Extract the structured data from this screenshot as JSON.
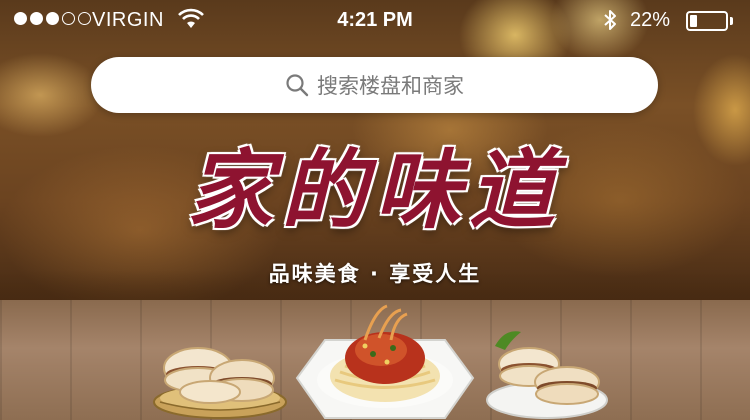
{
  "status_bar": {
    "carrier": "VIRGIN",
    "time": "4:21 PM",
    "battery_percent": "22%",
    "battery_level": 0.22,
    "signal_bars_filled": 3,
    "signal_bars_total": 5,
    "icons": [
      "wifi-icon",
      "bluetooth-icon",
      "battery-icon"
    ]
  },
  "search": {
    "placeholder": "搜索楼盘和商家",
    "icon": "search-icon"
  },
  "banner": {
    "title": "家的味道",
    "tagline": "品味美食 · 享受人生",
    "title_color": "#8e1330",
    "dishes": [
      "roujiamo-basket",
      "noodle-plate",
      "roujiamo-plate"
    ]
  }
}
